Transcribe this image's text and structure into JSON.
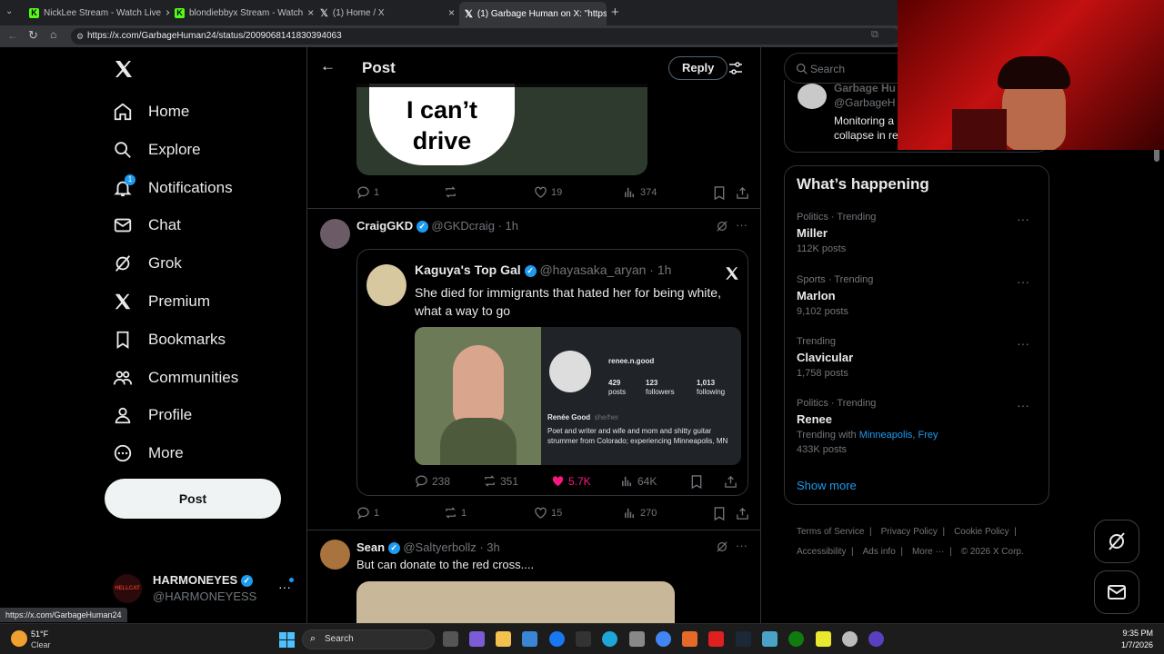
{
  "browser": {
    "tabs": [
      {
        "title": "NickLee Stream - Watch Live",
        "icon": "kick-icon"
      },
      {
        "title": "blondiebbyx Stream - Watch",
        "icon": "kick-icon"
      },
      {
        "title": "(1) Home / X",
        "icon": "x-logo-icon"
      },
      {
        "title": "(1) Garbage Human on X: \"https://",
        "icon": "x-logo-icon"
      }
    ],
    "new_tab": "+",
    "url": "https://x.com/GarbageHuman24/status/2009068141830394063",
    "status_url": "https://x.com/GarbageHuman24"
  },
  "nav": {
    "items": [
      {
        "label": "Home",
        "icon": "home-icon"
      },
      {
        "label": "Explore",
        "icon": "search-icon"
      },
      {
        "label": "Notifications",
        "icon": "bell-icon",
        "badge": "1"
      },
      {
        "label": "Chat",
        "icon": "mail-icon"
      },
      {
        "label": "Grok",
        "icon": "grok-icon"
      },
      {
        "label": "Premium",
        "icon": "x-logo-icon"
      },
      {
        "label": "Bookmarks",
        "icon": "bookmark-icon"
      },
      {
        "label": "Communities",
        "icon": "communities-icon"
      },
      {
        "label": "Profile",
        "icon": "person-icon"
      },
      {
        "label": "More",
        "icon": "more-circle-icon"
      }
    ],
    "post_label": "Post",
    "account": {
      "name": "HARMONEYES",
      "handle": "@HARMONEYESS",
      "avatar_text": "HELLCAT"
    }
  },
  "header": {
    "title": "Post",
    "reply_label": "Reply"
  },
  "feed": {
    "top_image_text": [
      "I can’t",
      "drive"
    ],
    "top_stats": {
      "replies": "1",
      "reposts": "",
      "likes": "19",
      "views": "374"
    },
    "post2": {
      "name": "CraigGKD",
      "handle": "@GKDcraig",
      "time": "· 1h",
      "quote": {
        "name": "Kaguya's Top Gal",
        "handle": "@hayasaka_aryan",
        "time": "· 1h",
        "text": "She died for immigrants that hated her for being white, what a way to go",
        "profile": {
          "username": "renee.n.good",
          "posts": "429",
          "posts_label": "posts",
          "followers": "123",
          "followers_label": "followers",
          "following": "1,013",
          "following_label": "following",
          "display_name": "Renée Good",
          "pronouns": "she/her",
          "bio": "Poet and writer and wife and mom and shitty guitar strummer from Colorado; experiencing Minneapolis, MN"
        },
        "stats": {
          "replies": "238",
          "reposts": "351",
          "likes": "5.7K",
          "views": "64K"
        }
      },
      "stats": {
        "replies": "1",
        "reposts": "1",
        "likes": "15",
        "views": "270"
      }
    },
    "post3": {
      "name": "Sean",
      "handle": "@Saltyerbollz",
      "time": "· 3h",
      "text": "But can donate to the red cross...."
    }
  },
  "right": {
    "search_placeholder": "Search",
    "pinned_user": {
      "name": "Garbage Hu",
      "handle": "@GarbageH",
      "text": [
        "Monitoring a",
        "collapse in re"
      ]
    },
    "whats_happening": "What’s happening",
    "trends": [
      {
        "meta": "Politics · Trending",
        "name": "Miller",
        "count": "112K posts"
      },
      {
        "meta": "Sports · Trending",
        "name": "Marlon",
        "count": "9,102 posts"
      },
      {
        "meta": "Trending",
        "name": "Clavicular",
        "count": "1,758 posts"
      },
      {
        "meta": "Politics · Trending",
        "name": "Renee",
        "with_label": "Trending with",
        "with_links": "Minneapolis, Frey",
        "count": "433K posts"
      }
    ],
    "show_more": "Show more",
    "footer": [
      "Terms of Service",
      "Privacy Policy",
      "Cookie Policy",
      "Accessibility",
      "Ads info",
      "More ···",
      "© 2026 X Corp."
    ]
  },
  "taskbar": {
    "weather_temp": "51°F",
    "weather_desc": "Clear",
    "search": "Search",
    "time": "9:35 PM",
    "date": "1/7/2026"
  },
  "colors": {
    "accent": "#1d9bf0",
    "like": "#f91880",
    "bg": "#000000",
    "border": "#2f3336",
    "muted": "#71767b"
  }
}
